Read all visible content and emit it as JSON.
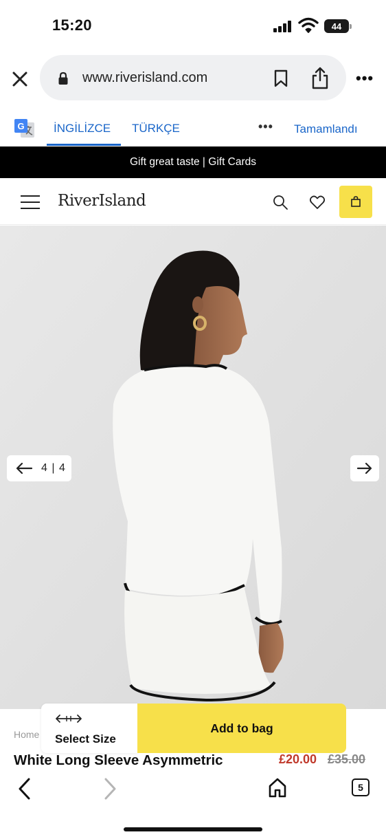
{
  "status": {
    "time": "15:20",
    "battery": "44"
  },
  "browser": {
    "url": "www.riverisland.com",
    "tab_count": "5"
  },
  "translate": {
    "source_language": "İNGİLİZCE",
    "target_language": "TÜRKÇE",
    "more": "•••",
    "done": "Tamamlandı"
  },
  "promo": {
    "text": "Gift great taste | Gift Cards"
  },
  "header": {
    "logo": "RiverIsland"
  },
  "gallery": {
    "counter": "4 | 4",
    "current": 4,
    "total": 4
  },
  "product": {
    "breadcrumb": "Home",
    "title": "White Long Sleeve Asymmetric",
    "price_sale": "£20.00",
    "price_original": "£35.00"
  },
  "buy_bar": {
    "select_size_label": "Select Size",
    "add_to_bag_label": "Add to bag"
  },
  "colors": {
    "accent_yellow": "#f7e04a",
    "link_blue": "#1a66c9",
    "sale_red": "#c0392b",
    "banner_black": "#000000"
  }
}
